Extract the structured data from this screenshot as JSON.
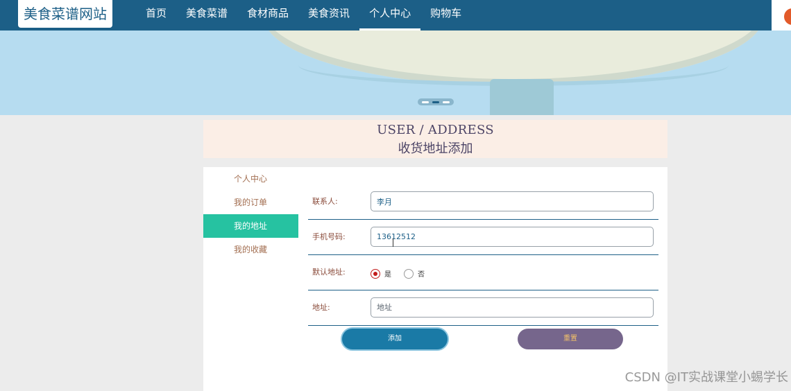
{
  "site": {
    "logo": "美食菜谱网站"
  },
  "nav": {
    "items": [
      {
        "label": "首页"
      },
      {
        "label": "美食菜谱"
      },
      {
        "label": "食材商品"
      },
      {
        "label": "美食资讯"
      },
      {
        "label": "个人中心"
      },
      {
        "label": "购物车"
      }
    ],
    "active": "个人中心"
  },
  "title": {
    "en": "USER / ADDRESS",
    "cn": "收货地址添加"
  },
  "sidebar": {
    "items": [
      {
        "label": "个人中心"
      },
      {
        "label": "我的订单"
      },
      {
        "label": "我的地址"
      },
      {
        "label": "我的收藏"
      }
    ],
    "active": "我的地址"
  },
  "form": {
    "contact": {
      "label": "联系人:",
      "value": "李月"
    },
    "phone": {
      "label": "手机号码:",
      "value": "13612512"
    },
    "default": {
      "label": "默认地址:",
      "yes": "是",
      "no": "否",
      "selected": "是"
    },
    "address": {
      "label": "地址:",
      "placeholder": "地址"
    }
  },
  "buttons": {
    "add": "添加",
    "reset": "重置"
  },
  "watermark": "CSDN @IT实战课堂小蜴学长",
  "colors": {
    "nav": "#1c5f87",
    "active_side": "#26c2a1",
    "reset_button": "#76668c"
  }
}
